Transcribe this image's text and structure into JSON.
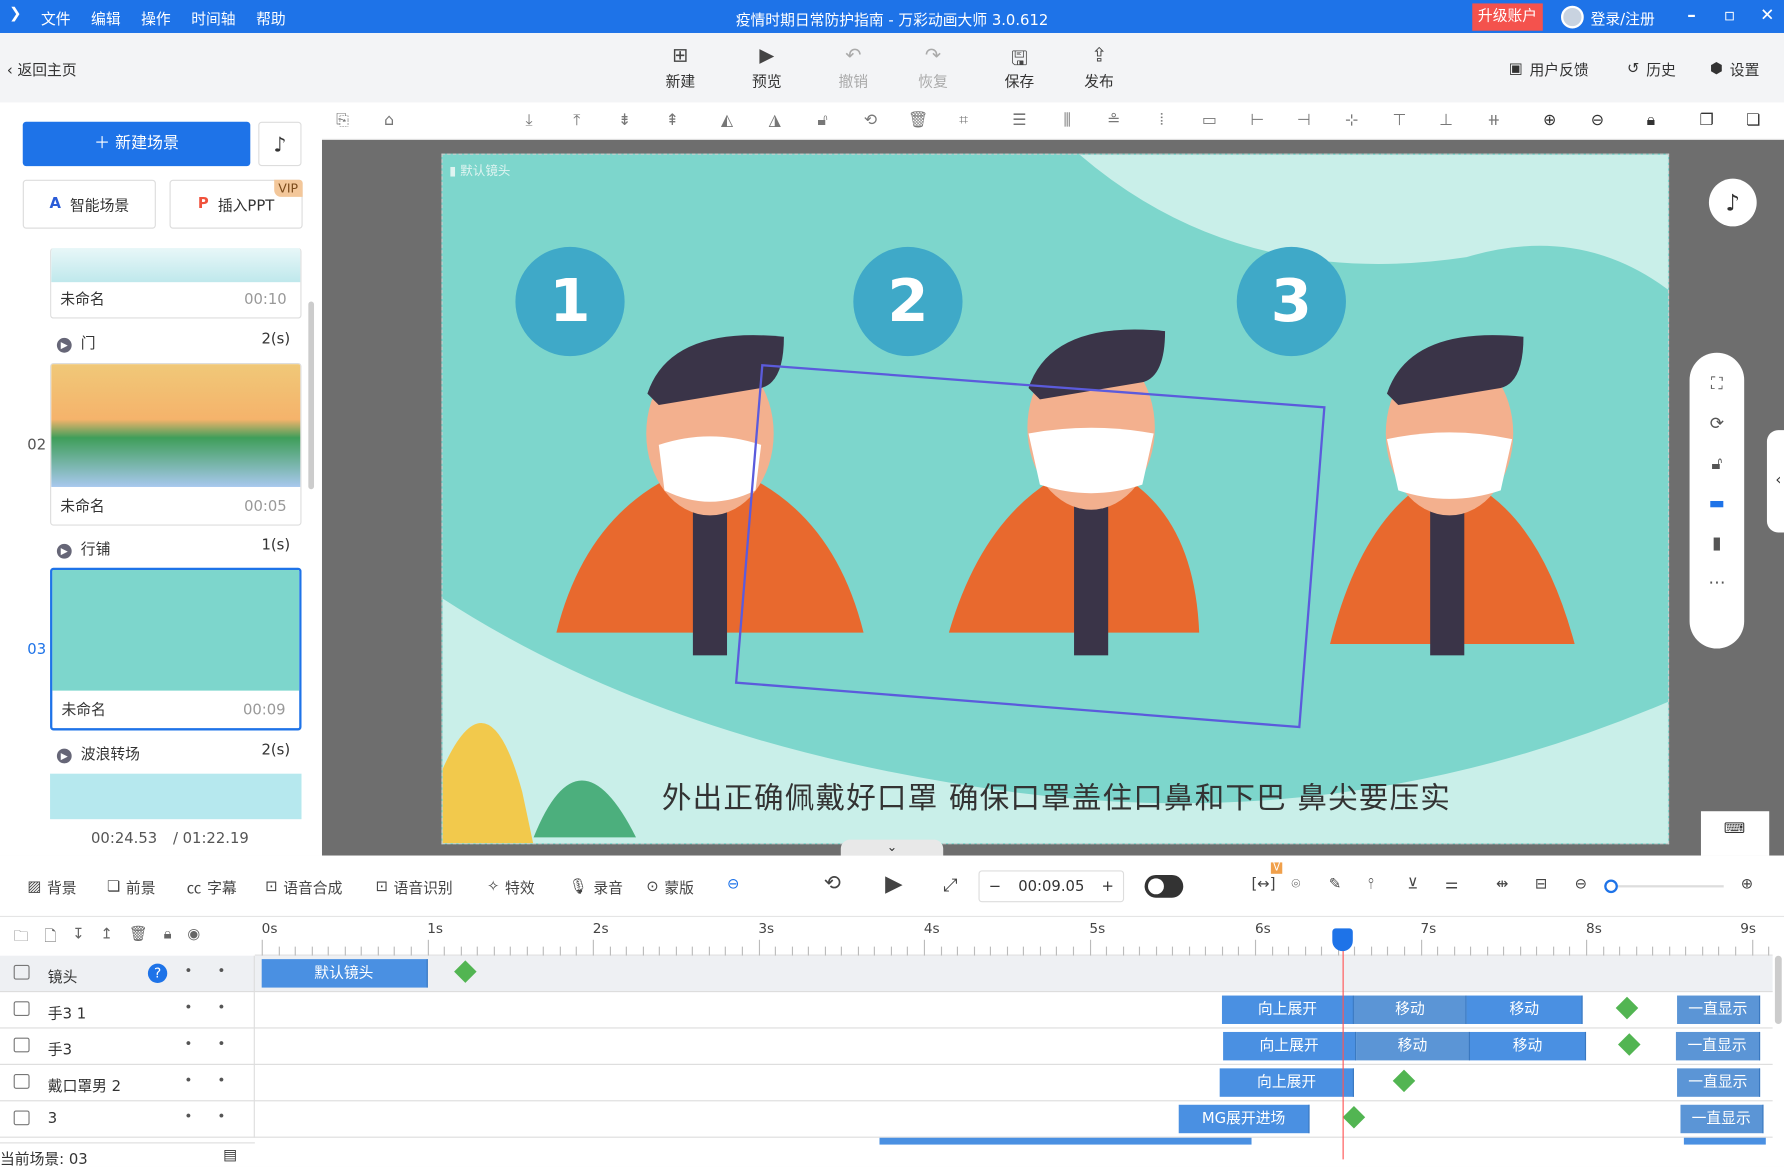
{
  "titlebar": {
    "menu": [
      "文件",
      "编辑",
      "操作",
      "时间轴",
      "帮助"
    ],
    "title": "疫情时期日常防护指南 - 万彩动画大师 3.0.612",
    "upgrade": "升级账户",
    "login": "登录/注册"
  },
  "toolbar": {
    "back": "返回主页",
    "buttons": [
      {
        "label": "新建",
        "icon": "plus-square"
      },
      {
        "label": "预览",
        "icon": "play"
      },
      {
        "label": "撤销",
        "icon": "undo"
      },
      {
        "label": "恢复",
        "icon": "redo"
      },
      {
        "label": "保存",
        "icon": "save"
      },
      {
        "label": "发布",
        "icon": "publish"
      }
    ],
    "feedback": "用户反馈",
    "history": "历史",
    "settings": "设置"
  },
  "left": {
    "new_scene": "新建场景",
    "smart_scene": "智能场景",
    "insert_ppt": "插入PPT",
    "vip": "VIP",
    "scenes": [
      {
        "index": "",
        "name": "未命名",
        "time": "00:10"
      },
      {
        "index": "02",
        "name": "未命名",
        "time": "00:05"
      },
      {
        "index": "03",
        "name": "未命名",
        "time": "00:09"
      }
    ],
    "transitions": [
      {
        "name": "门",
        "dur": "2(s)"
      },
      {
        "name": "行铺",
        "dur": "1(s)"
      },
      {
        "name": "波浪转场",
        "dur": "2(s)"
      }
    ],
    "current_time": "00:24.53",
    "total_time": "/ 01:22.19"
  },
  "stage": {
    "camera_label": "默认镜头",
    "numbers": [
      "1",
      "2",
      "3"
    ],
    "subtitle": "外出正确佩戴好口罩 确保口罩盖住口鼻和下巴 鼻尖要压实"
  },
  "bottom_toolbar": {
    "items": [
      "背景",
      "前景",
      "字幕",
      "语音合成",
      "语音识别",
      "特效",
      "录音",
      "蒙版"
    ],
    "time": "00:09.05",
    "v_badge": "V"
  },
  "timeline": {
    "ticks": [
      "0s",
      "1s",
      "2s",
      "3s",
      "4s",
      "5s",
      "6s",
      "7s",
      "8s",
      "9s"
    ],
    "playhead_s": 6.5,
    "rows": [
      {
        "name": "镜头",
        "blocks": [
          {
            "label": "默认镜头",
            "start": 0,
            "end": 1
          }
        ],
        "keyframes": [
          1.23
        ]
      },
      {
        "name": "手3 1",
        "blocks": [
          {
            "label": "向上展开",
            "start": 5.8,
            "end": 6.6
          },
          {
            "label": "移动",
            "start": 6.6,
            "end": 7.28
          },
          {
            "label": "移动",
            "start": 7.28,
            "end": 7.98
          },
          {
            "label": "一直显示",
            "start": 8.55,
            "end": 9.05
          }
        ],
        "keyframes": [
          8.25
        ]
      },
      {
        "name": "手3",
        "blocks": [
          {
            "label": "向上展开",
            "start": 5.81,
            "end": 6.61
          },
          {
            "label": "移动",
            "start": 6.61,
            "end": 7.3
          },
          {
            "label": "移动",
            "start": 7.3,
            "end": 8.0
          },
          {
            "label": "一直显示",
            "start": 8.54,
            "end": 9.05
          }
        ],
        "keyframes": [
          8.26
        ]
      },
      {
        "name": "戴口罩男 2",
        "blocks": [
          {
            "label": "向上展开",
            "start": 5.79,
            "end": 6.6
          }
        ],
        "keyframes": [
          6.9
        ],
        "tail": {
          "label": "一直显示",
          "start": 8.55,
          "end": 9.05
        }
      },
      {
        "name": "3",
        "blocks": [
          {
            "label": "MG展开进场",
            "start": 5.54,
            "end": 6.33
          },
          {
            "label": "一直显示",
            "start": 8.57,
            "end": 9.07
          }
        ],
        "keyframes": [
          6.6
        ]
      }
    ]
  },
  "status": {
    "current_scene": "当前场景: 03"
  }
}
